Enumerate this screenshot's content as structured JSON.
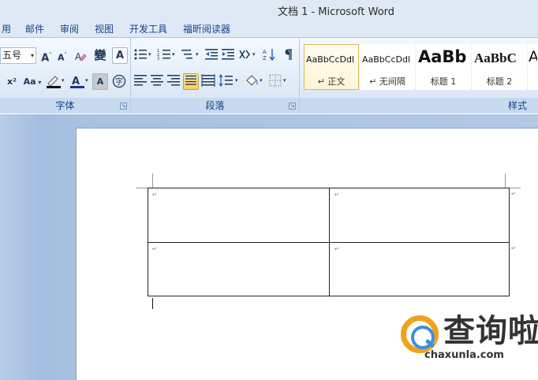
{
  "window": {
    "title": "文档 1 - Microsoft Word"
  },
  "menu_tabs": [
    "用",
    "邮件",
    "审阅",
    "视图",
    "开发工具",
    "福昕阅读器"
  ],
  "ribbon": {
    "font_group": {
      "label": "字体",
      "font_size": "五号",
      "grow_font": "A",
      "shrink_font": "A",
      "clear_format": "A",
      "phonetic_guide": "變",
      "char_border": "A",
      "superscript": "x²",
      "change_case": "Aa",
      "font_color": "A",
      "char_shading": "A",
      "enclose_char": "字"
    },
    "paragraph_group": {
      "label": "段落"
    },
    "styles_group": {
      "label": "样式",
      "styles": [
        {
          "sample": "AaBbCcDdl",
          "name": "↵ 正文"
        },
        {
          "sample": "AaBbCcDdl",
          "name": "↵ 无间隔"
        },
        {
          "sample": "AaBb",
          "name": "标题 1"
        },
        {
          "sample": "AaBbC",
          "name": "标题 2"
        },
        {
          "sample": "A",
          "name": ""
        }
      ]
    }
  },
  "document": {
    "paragraph_mark": "↵",
    "table": {
      "rows": 2,
      "cols": 2
    }
  },
  "watermark": {
    "name": "查询啦",
    "domain": "chaxunla.com"
  }
}
